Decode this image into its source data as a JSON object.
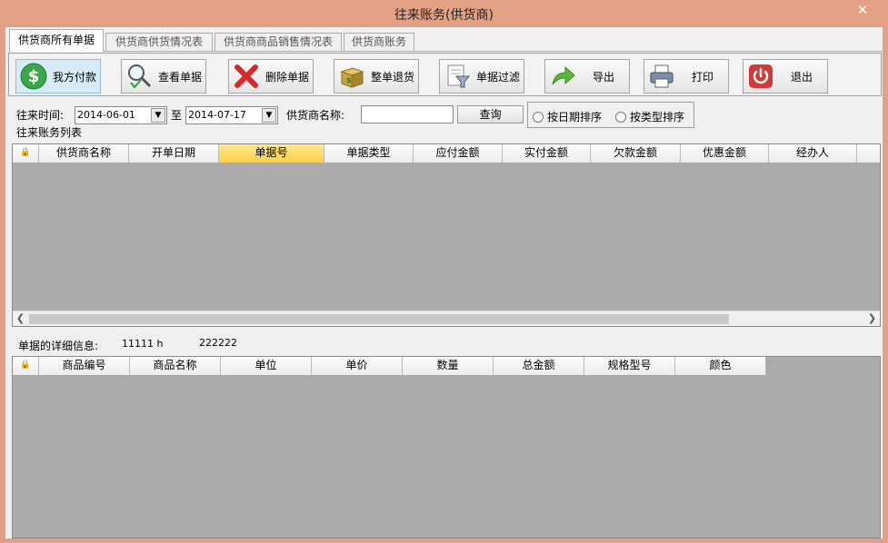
{
  "window": {
    "title": "往来账务(供货商)",
    "close_glyph": "✕"
  },
  "tabs": [
    {
      "label": "供货商所有单据",
      "active": true
    },
    {
      "label": "供货商供货情况表"
    },
    {
      "label": "供货商商品销售情况表"
    },
    {
      "label": "供货商账务"
    }
  ],
  "toolbar": {
    "pay": "我方付款",
    "view": "查看单据",
    "delete": "删除单据",
    "return": "整单退货",
    "filter": "单据过滤",
    "export": "导出",
    "print": "打印",
    "exit": "退出"
  },
  "filter": {
    "date_label": "往来时间:",
    "date_from": "2014-06-01",
    "to_label": "至",
    "date_to": "2014-07-17",
    "supplier_label": "供货商名称:",
    "supplier_value": "",
    "query_button": "查询",
    "sort_by_date": "按日期排序",
    "sort_by_type": "按类型排序"
  },
  "list": {
    "title": "往来账务列表",
    "lock_glyph": "🔒",
    "columns": [
      "供货商名称",
      "开单日期",
      "单据号",
      "单据类型",
      "应付金额",
      "实付金额",
      "欠款金额",
      "优惠金额",
      "经办人"
    ],
    "selected_column": "单据号",
    "rows": []
  },
  "detail": {
    "label": "单据的详细信息:",
    "value1": "11111 h",
    "value2": "222222"
  },
  "items": {
    "lock_glyph": "🔒",
    "columns": [
      "商品编号",
      "商品名称",
      "单位",
      "单价",
      "数量",
      "总金额",
      "规格型号",
      "颜色"
    ],
    "rows": []
  },
  "colors": {
    "titlebar": "#e2a184",
    "grid_empty": "#ababab",
    "selected_header": "#fbd04a"
  }
}
